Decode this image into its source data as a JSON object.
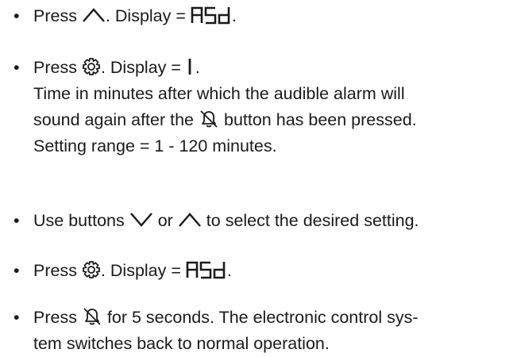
{
  "colors": {
    "text": "#1a1a1a",
    "icon_stroke": "#1a1a1a"
  },
  "icons": {
    "up": "chevron-up-icon",
    "down": "chevron-down-icon",
    "settings": "gear-icon",
    "alarm_off": "bell-mute-icon"
  },
  "bullet_glyph": "•",
  "steps": [
    {
      "pre": "Press",
      "mid": ". Display =",
      "display_code": "ASd",
      "post": "."
    },
    {
      "pre": "Press",
      "mid": ". Display =",
      "display_code": "1",
      "post": ".",
      "desc_line1": "Time in minutes after which the audible alarm will",
      "desc_line2_pre": "sound again after the",
      "desc_line2_post": "button has been pressed.",
      "desc_line3": "Setting range = 1 - 120 minutes."
    },
    {
      "pre": "Use buttons",
      "or": "or",
      "post": "to select the desired setting."
    },
    {
      "pre": "Press",
      "mid": ". Display =",
      "display_code": "ASd",
      "post": "."
    },
    {
      "pre": "Press",
      "line1_post": "for 5 seconds. The electronic control sys-",
      "line2": "tem switches back to normal operation."
    }
  ]
}
